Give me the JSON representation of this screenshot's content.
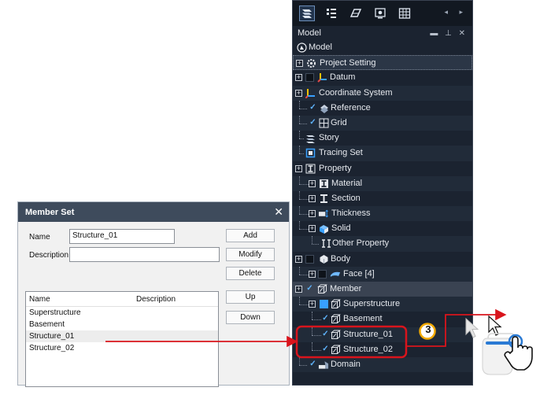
{
  "tree_panel": {
    "title": "Model",
    "title_controls": "▬ ⊥ ✕",
    "toolbar_icons": [
      "model-tree-icon",
      "layers-icon",
      "story-icon",
      "view-icon",
      "table-icon"
    ],
    "nav_arrows": "◂ ▸",
    "rows": [
      {
        "label": "Model",
        "icon": "model-icon"
      },
      {
        "label": "Project Setting",
        "icon": "gear-icon"
      },
      {
        "label": "Datum",
        "icon": "datum-icon"
      },
      {
        "label": "Coordinate System",
        "icon": "axes-icon"
      },
      {
        "label": "Reference",
        "icon": "reference-icon"
      },
      {
        "label": "Grid",
        "icon": "grid-icon"
      },
      {
        "label": "Story",
        "icon": "story-icon"
      },
      {
        "label": "Tracing Set",
        "icon": "tracing-icon"
      },
      {
        "label": "Property",
        "icon": "property-icon"
      },
      {
        "label": "Material",
        "icon": "material-icon"
      },
      {
        "label": "Section",
        "icon": "section-icon"
      },
      {
        "label": "Thickness",
        "icon": "thickness-icon"
      },
      {
        "label": "Solid",
        "icon": "solid-icon"
      },
      {
        "label": "Other Property",
        "icon": "other-property-icon"
      },
      {
        "label": "Body",
        "icon": "body-icon"
      },
      {
        "label": "Face [4]",
        "icon": "face-icon"
      },
      {
        "label": "Member",
        "icon": "member-icon"
      },
      {
        "label": "Superstructure",
        "icon": "member-icon"
      },
      {
        "label": "Basement",
        "icon": "member-icon"
      },
      {
        "label": "Structure_01",
        "icon": "member-icon"
      },
      {
        "label": "Structure_02",
        "icon": "member-icon"
      },
      {
        "label": "Domain",
        "icon": "domain-icon"
      }
    ]
  },
  "dialog": {
    "title": "Member Set",
    "name_label": "Name",
    "name_value": "Structure_01",
    "description_label": "Description",
    "description_value": "",
    "buttons": {
      "add": "Add",
      "modify": "Modify",
      "delete": "Delete",
      "up": "Up",
      "down": "Down"
    },
    "list": {
      "headers": {
        "name": "Name",
        "description": "Description"
      },
      "rows": [
        "Superstructure",
        "Basement",
        "Structure_01",
        "Structure_02"
      ],
      "selected": "Structure_01"
    }
  },
  "annotation": {
    "step_number": "3",
    "highlight_color": "#d9141c",
    "arrow_color": "#d9141c",
    "cursor_icon": "hand-pointer-icon"
  },
  "colors": {
    "panel_bg": "#1b2330",
    "check_blue": "#5fb4ff",
    "dialog_title_bg": "#3e4b5c"
  }
}
